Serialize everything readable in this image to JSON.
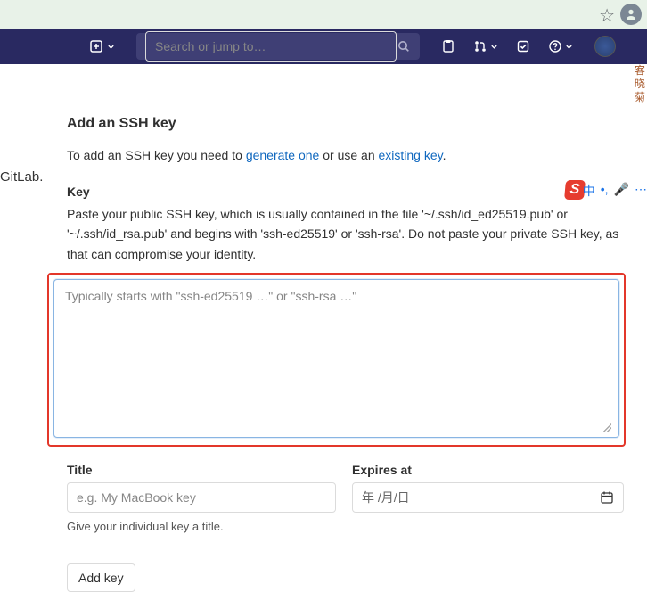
{
  "chrome": {
    "star_icon": "star-outline",
    "profile_icon": "person"
  },
  "nav": {
    "plus_icon": "plus",
    "search_placeholder": "Search or jump to…",
    "search_icon": "magnifier",
    "issues_icon": "clipboard",
    "mr_icon": "merge-request",
    "todo_icon": "todo-check",
    "help_icon": "question-circle",
    "caret": "caret-down"
  },
  "floating_name": "客\n晓\n菊",
  "sidebar_text": "GitLab.",
  "sogou": {
    "letter": "S",
    "lang": "中",
    "dot": "•,",
    "mic": "mic"
  },
  "form": {
    "heading": "Add an SSH key",
    "intro_before": "To add an SSH key you need to ",
    "link_generate": "generate one",
    "intro_mid": " or use an ",
    "link_existing": "existing key",
    "intro_after": ".",
    "key_label": "Key",
    "key_desc": "Paste your public SSH key, which is usually contained in the file '~/.ssh/id_ed25519.pub' or '~/.ssh/id_rsa.pub' and begins with 'ssh-ed25519' or 'ssh-rsa'. Do not paste your private SSH key, as that can compromise your identity.",
    "key_placeholder": "Typically starts with \"ssh-ed25519 …\" or \"ssh-rsa …\"",
    "title_label": "Title",
    "title_placeholder": "e.g. My MacBook key",
    "title_hint": "Give your individual key a title.",
    "expires_label": "Expires at",
    "expires_value": "年 /月/日",
    "submit": "Add key"
  }
}
